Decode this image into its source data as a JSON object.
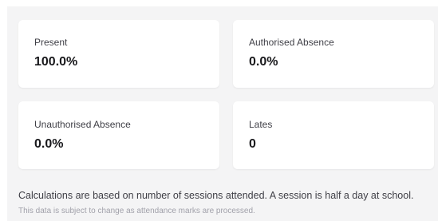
{
  "cards": [
    {
      "label": "Present",
      "value": "100.0%"
    },
    {
      "label": "Authorised Absence",
      "value": "0.0%"
    },
    {
      "label": "Unauthorised Absence",
      "value": "0.0%"
    },
    {
      "label": "Lates",
      "value": "0"
    }
  ],
  "footer": {
    "note": "Calculations are based on number of sessions attended. A session is half a day at school.",
    "subnote": "This data is subject to change as attendance marks are processed."
  }
}
